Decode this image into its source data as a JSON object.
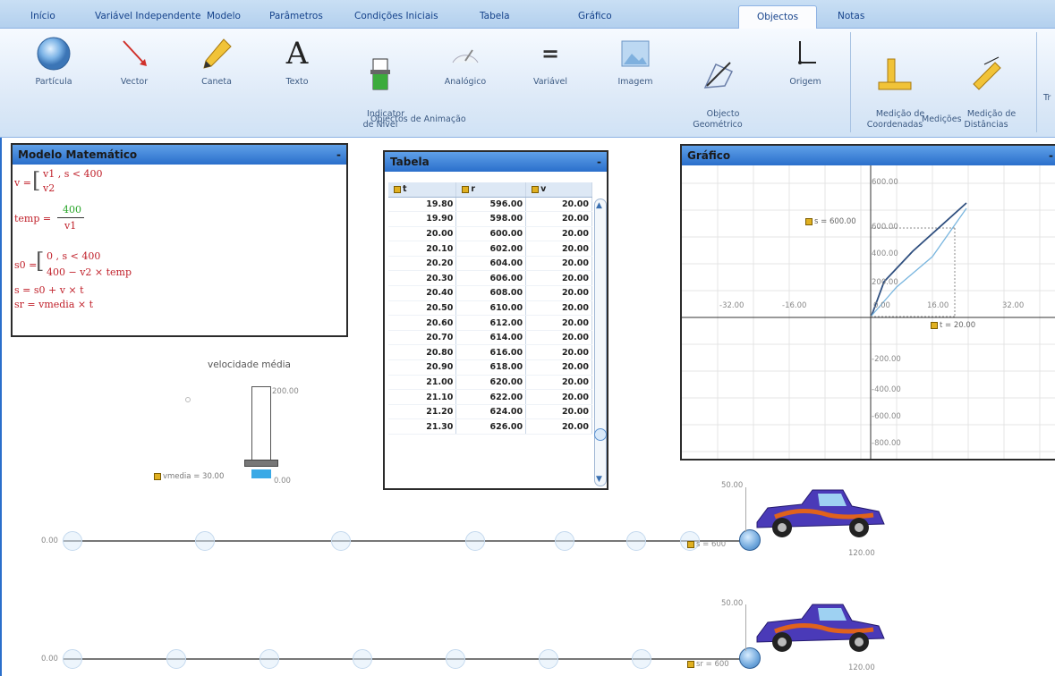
{
  "tabs": [
    "Início",
    "Variável Independente",
    "Modelo",
    "Parâmetros",
    "Condições Iniciais",
    "Tabela",
    "Gráfico",
    "Objectos",
    "Notas"
  ],
  "ribbon": {
    "items": [
      "Partícula",
      "Vector",
      "Caneta",
      "Texto",
      "Indicator\nde Nível",
      "Analógico",
      "Variável",
      "Imagem",
      "Objecto\nGeométrico",
      "Origem",
      "Medição de\nCoordenadas",
      "Medição de\nDistâncias"
    ],
    "group_animation": "Objectos de Animação",
    "group_measure": "Medições",
    "cut_label": "Tr"
  },
  "model": {
    "title": "Modelo Matemático",
    "minimize": "-",
    "lines": {
      "v_lhs": "v =",
      "v_case1": "v1 , s < 400",
      "v_case2": "v2",
      "temp_lhs": "temp =",
      "temp_num": "400",
      "temp_den": "v1",
      "s0_lhs": "s0 =",
      "s0_case1": "0 , s < 400",
      "s0_case2": "400 − v2 × temp",
      "s_eq": "s = s0 + v × t",
      "sr_eq": "sr = vmedia × t"
    }
  },
  "level_indicator": {
    "title": "velocidade média",
    "max": "200.00",
    "min": "0.00",
    "readout": "vmedia = 30.00"
  },
  "table": {
    "title": "Tabela",
    "minimize": "-",
    "columns": [
      "t",
      "r",
      "v"
    ],
    "rows": [
      [
        "19.80",
        "596.00",
        "20.00"
      ],
      [
        "19.90",
        "598.00",
        "20.00"
      ],
      [
        "20.00",
        "600.00",
        "20.00"
      ],
      [
        "20.10",
        "602.00",
        "20.00"
      ],
      [
        "20.20",
        "604.00",
        "20.00"
      ],
      [
        "20.30",
        "606.00",
        "20.00"
      ],
      [
        "20.40",
        "608.00",
        "20.00"
      ],
      [
        "20.50",
        "610.00",
        "20.00"
      ],
      [
        "20.60",
        "612.00",
        "20.00"
      ],
      [
        "20.70",
        "614.00",
        "20.00"
      ],
      [
        "20.80",
        "616.00",
        "20.00"
      ],
      [
        "20.90",
        "618.00",
        "20.00"
      ],
      [
        "21.00",
        "620.00",
        "20.00"
      ],
      [
        "21.10",
        "622.00",
        "20.00"
      ],
      [
        "21.20",
        "624.00",
        "20.00"
      ],
      [
        "21.30",
        "626.00",
        "20.00"
      ]
    ]
  },
  "graph": {
    "title": "Gráfico",
    "minimize": "-",
    "x_ticks": [
      "-32.00",
      "-16.00",
      "16.00",
      "32.00"
    ],
    "y_ticks": [
      "600.00",
      "400.00",
      "200.00",
      "-200.00",
      "-400.00",
      "-600.00",
      "-800.00"
    ],
    "y_plus": "600.00",
    "readout_s": "s = 600.00",
    "readout_t": "t = 20.00",
    "zero": "0.00",
    "zero_y": "00"
  },
  "animation": {
    "track1": {
      "start": "0.00",
      "top": "50.00",
      "end": "120.00",
      "readout": "s = 600"
    },
    "track2": {
      "start": "0.00",
      "top": "50.00",
      "end": "120.00",
      "readout": "sr = 600"
    }
  },
  "colors": {
    "ribbon": "#dbe8f7",
    "title_bar": "#2a6fcb",
    "equation_red": "#c0202a",
    "equation_green": "#2aa52a"
  }
}
